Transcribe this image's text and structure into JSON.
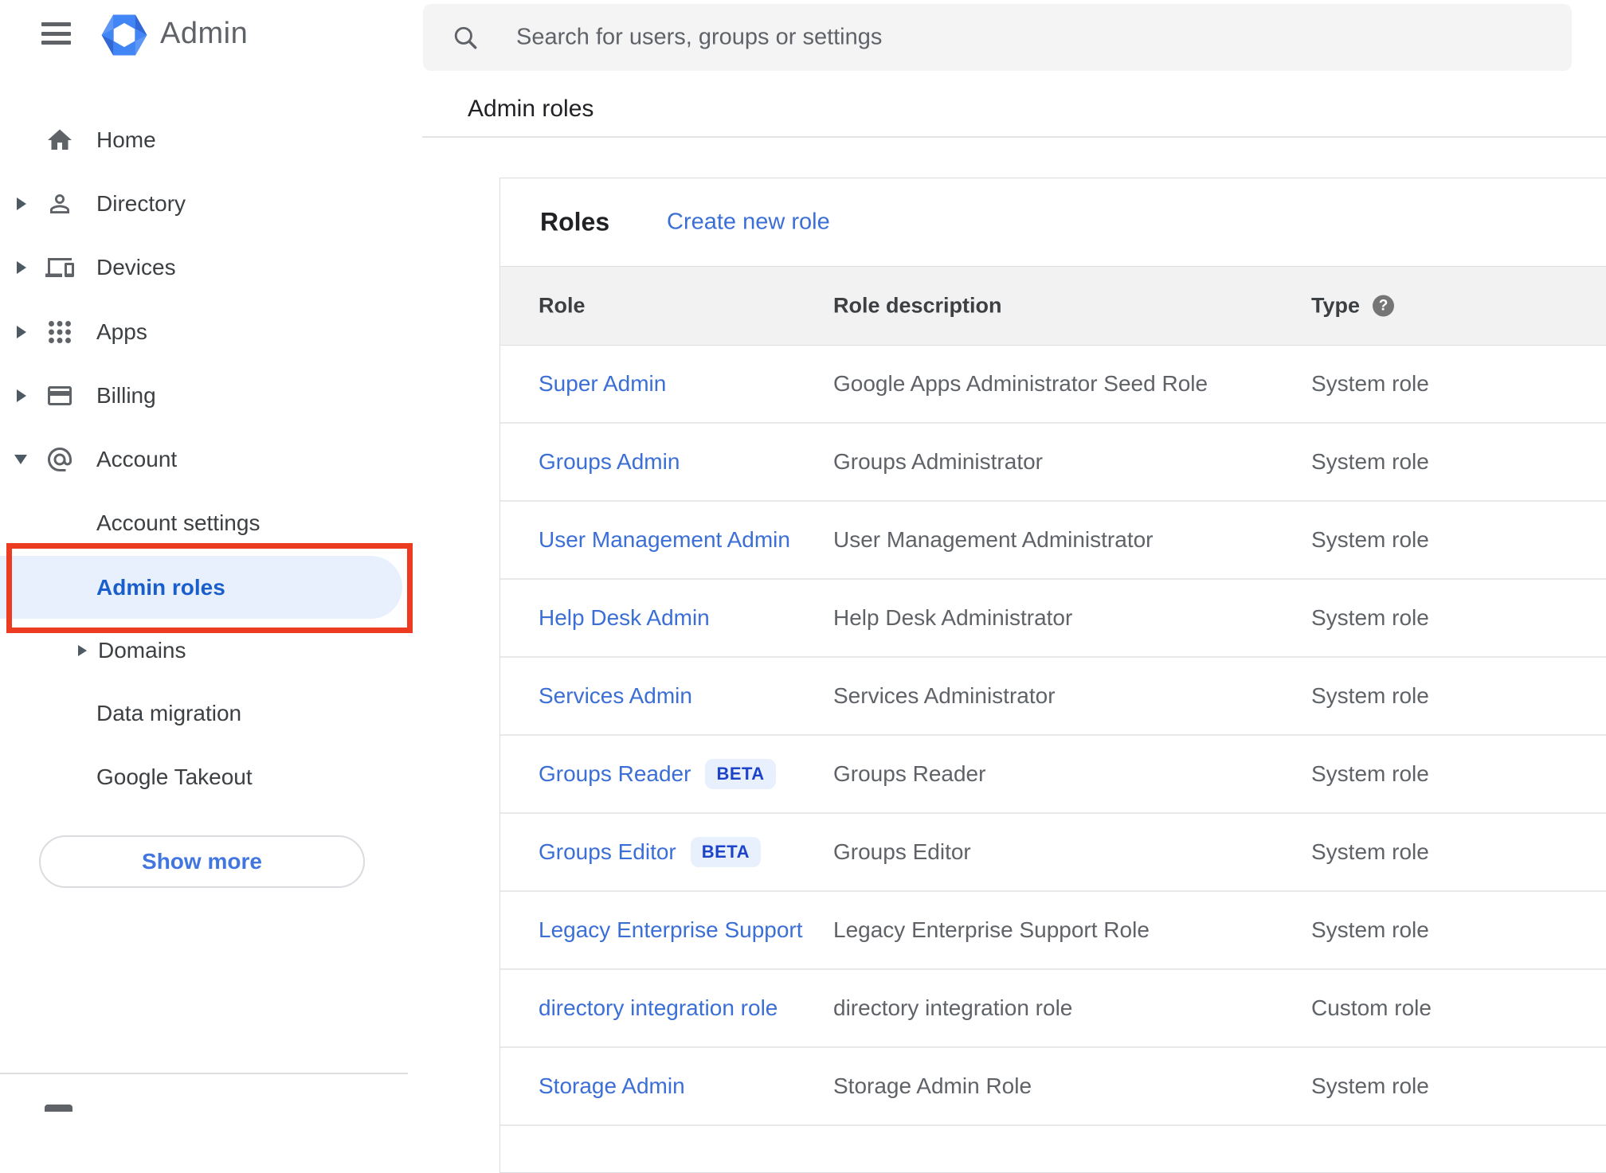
{
  "app": {
    "logo_text": "Admin"
  },
  "search": {
    "placeholder": "Search for users, groups or settings"
  },
  "breadcrumb": "Admin roles",
  "sidebar": {
    "items": [
      {
        "label": "Home",
        "icon": "home-icon",
        "expandable": false
      },
      {
        "label": "Directory",
        "icon": "person-icon",
        "expandable": true
      },
      {
        "label": "Devices",
        "icon": "devices-icon",
        "expandable": true
      },
      {
        "label": "Apps",
        "icon": "apps-grid-icon",
        "expandable": true
      },
      {
        "label": "Billing",
        "icon": "credit-card-icon",
        "expandable": true
      },
      {
        "label": "Account",
        "icon": "at-sign-icon",
        "expandable": true,
        "expanded": true
      }
    ],
    "account_children": [
      {
        "label": "Account settings",
        "selected": false
      },
      {
        "label": "Admin roles",
        "selected": true
      },
      {
        "label": "Domains",
        "expandable": true,
        "selected": false
      },
      {
        "label": "Data migration",
        "selected": false
      },
      {
        "label": "Google Takeout",
        "selected": false
      }
    ],
    "show_more_label": "Show more"
  },
  "main": {
    "roles_title": "Roles",
    "create_new_role": "Create new role",
    "table": {
      "headers": {
        "role": "Role",
        "description": "Role description",
        "type": "Type"
      },
      "help_icon": "?",
      "beta_label": "BETA",
      "rows": [
        {
          "role": "Super Admin",
          "description": "Google Apps Administrator Seed Role",
          "type": "System role"
        },
        {
          "role": "Groups Admin",
          "description": "Groups Administrator",
          "type": "System role"
        },
        {
          "role": "User Management Admin",
          "description": "User Management Administrator",
          "type": "System role"
        },
        {
          "role": "Help Desk Admin",
          "description": "Help Desk Administrator",
          "type": "System role"
        },
        {
          "role": "Services Admin",
          "description": "Services Administrator",
          "type": "System role"
        },
        {
          "role": "Groups Reader",
          "beta": true,
          "description": "Groups Reader",
          "type": "System role"
        },
        {
          "role": "Groups Editor",
          "beta": true,
          "description": "Groups Editor",
          "type": "System role"
        },
        {
          "role": "Legacy Enterprise Support",
          "description": "Legacy Enterprise Support Role",
          "type": "System role"
        },
        {
          "role": "directory integration role",
          "description": "directory integration role",
          "type": "Custom role"
        },
        {
          "role": "Storage Admin",
          "description": "Storage Admin Role",
          "type": "System role"
        }
      ]
    }
  },
  "annotation": {
    "shape": "rectangle",
    "color": "#EB3B21",
    "target": "Admin roles sidebar item"
  },
  "colors": {
    "link_blue": "#3B6FD6",
    "selected_nav_blue": "#1A5ECB",
    "selected_nav_bg": "#E8F0FE",
    "badge_bg": "#E8F0FE",
    "badge_text": "#1D43C9",
    "logo_blue": "#4285F4",
    "logo_blue_dark": "#3367D6",
    "header_row_bg": "#F2F2F3",
    "search_bg": "#F4F4F5"
  }
}
